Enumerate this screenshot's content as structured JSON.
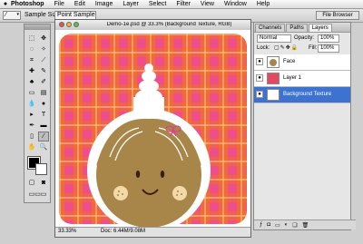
{
  "menubar": {
    "app_name": "Photoshop",
    "items": [
      "File",
      "Edit",
      "Image",
      "Layer",
      "Select",
      "Filter",
      "View",
      "Window",
      "Help"
    ]
  },
  "options_bar": {
    "sample_size_label": "Sample Size:",
    "sample_size_value": "Point Sample",
    "file_browser_label": "File Browser"
  },
  "document": {
    "title": "Demo-1e.psd @ 33.3% (Background Texture, RGB)",
    "zoom": "33.33%",
    "doc_info": "Doc: 6.44M/9.08M"
  },
  "palette": {
    "tabs": [
      "Channels",
      "Paths",
      "Layers"
    ],
    "active_tab": "Layers",
    "blend_mode": "Normal",
    "opacity_label": "Opacity:",
    "opacity_value": "100%",
    "lock_label": "Lock:",
    "fill_label": "Fill:",
    "fill_value": "100%",
    "layers": [
      {
        "name": "Face",
        "selected": false
      },
      {
        "name": "Layer 1",
        "selected": false
      },
      {
        "name": "Background Texture",
        "selected": true
      }
    ]
  },
  "colors": {
    "plaid_pink": "#ee4e8e",
    "plaid_orange": "#f4701c",
    "face_brown": "#a8864a",
    "layer_highlight": "#3d72d0"
  }
}
